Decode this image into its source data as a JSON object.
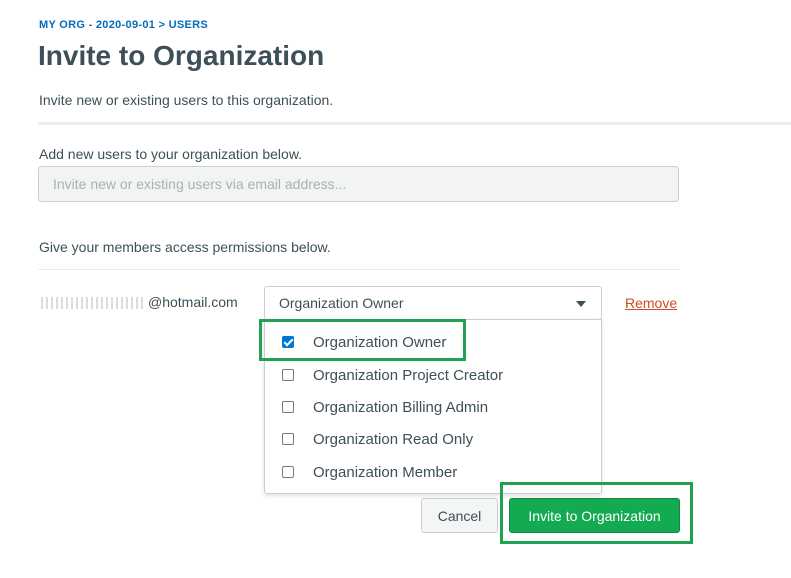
{
  "breadcrumb": {
    "org": "MY ORG - 2020-09-01",
    "separator": ">",
    "section": "USERS"
  },
  "page": {
    "title": "Invite to Organization",
    "subtitle": "Invite new or existing users to this organization."
  },
  "invite_section": {
    "label": "Add new users to your organization below.",
    "email_placeholder": "Invite new or existing users via email address...",
    "email_value": ""
  },
  "permissions_section": {
    "label": "Give your members access permissions below."
  },
  "member_row": {
    "email_visible_suffix": "@hotmail.com",
    "selected_role": "Organization Owner",
    "remove_label": "Remove"
  },
  "role_options": [
    {
      "label": "Organization Owner",
      "checked": true
    },
    {
      "label": "Organization Project Creator",
      "checked": false
    },
    {
      "label": "Organization Billing Admin",
      "checked": false
    },
    {
      "label": "Organization Read Only",
      "checked": false
    },
    {
      "label": "Organization Member",
      "checked": false
    }
  ],
  "buttons": {
    "cancel": "Cancel",
    "invite": "Invite to Organization"
  },
  "colors": {
    "primary_green": "#13aa52",
    "highlight_green": "#21a152",
    "link_blue": "#006cbc",
    "remove_red": "#cf4a22",
    "checkbox_blue": "#0076d7"
  },
  "icons": {
    "select_caret": "chevron-down-icon",
    "checkbox_checked": "checkbox-checked-icon",
    "checkbox_unchecked": "checkbox-unchecked-icon"
  }
}
